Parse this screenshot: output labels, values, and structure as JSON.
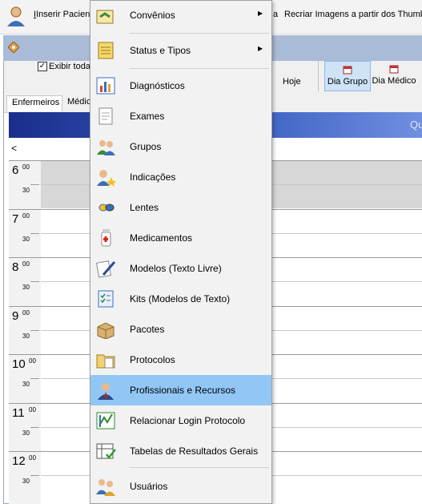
{
  "toolbar": {
    "insert_patient": "Inserir Pacient",
    "recreate": "Recriar Imagens a partir dos Thumb",
    "fragment_a": "a"
  },
  "window": {
    "show_all_label": "Exibir toda",
    "today_label": "Hoje",
    "view_buttons": [
      "Dia Grupo",
      "Dia Médico"
    ]
  },
  "tabs": [
    "Enfermeiros",
    "Médico"
  ],
  "blue_bar_text": "Qu",
  "nav": {
    "prev": "<"
  },
  "times": [
    {
      "hour": "6",
      "min": "00",
      "half": "30"
    },
    {
      "hour": "7",
      "min": "00",
      "half": "30"
    },
    {
      "hour": "8",
      "min": "00",
      "half": "30"
    },
    {
      "hour": "9",
      "min": "00",
      "half": "30"
    },
    {
      "hour": "10",
      "min": "00",
      "half": "30"
    },
    {
      "hour": "11",
      "min": "00",
      "half": "30"
    },
    {
      "hour": "12",
      "min": "00",
      "half": "30"
    }
  ],
  "menu": {
    "items": [
      {
        "label": "Convênios",
        "icon": "handshake-icon",
        "submenu": true
      },
      {
        "label": "Status e Tipos",
        "icon": "notepad-icon",
        "submenu": true
      },
      {
        "label": "Diagnósticos",
        "icon": "chart-icon"
      },
      {
        "label": "Exames",
        "icon": "document-icon"
      },
      {
        "label": "Grupos",
        "icon": "users-group-icon"
      },
      {
        "label": "Indicações",
        "icon": "user-star-icon"
      },
      {
        "label": "Lentes",
        "icon": "lens-icon"
      },
      {
        "label": "Medicamentos",
        "icon": "medicine-bottle-icon"
      },
      {
        "label": "Modelos (Texto Livre)",
        "icon": "pen-paper-icon"
      },
      {
        "label": "Kits (Modelos de Texto)",
        "icon": "checklist-icon"
      },
      {
        "label": "Pacotes",
        "icon": "box-icon"
      },
      {
        "label": "Protocolos",
        "icon": "folder-doc-icon"
      },
      {
        "label": "Profissionais e Recursos",
        "icon": "professional-icon",
        "highlighted": true
      },
      {
        "label": "Relacionar Login Protocolo",
        "icon": "link-icon"
      },
      {
        "label": "Tabelas de Resultados Gerais",
        "icon": "results-table-icon"
      },
      {
        "label": "Usuários",
        "icon": "users-icon"
      }
    ]
  },
  "colors": {
    "highlight": "#92c7f5",
    "blue_bar": "#1a2e8c"
  }
}
